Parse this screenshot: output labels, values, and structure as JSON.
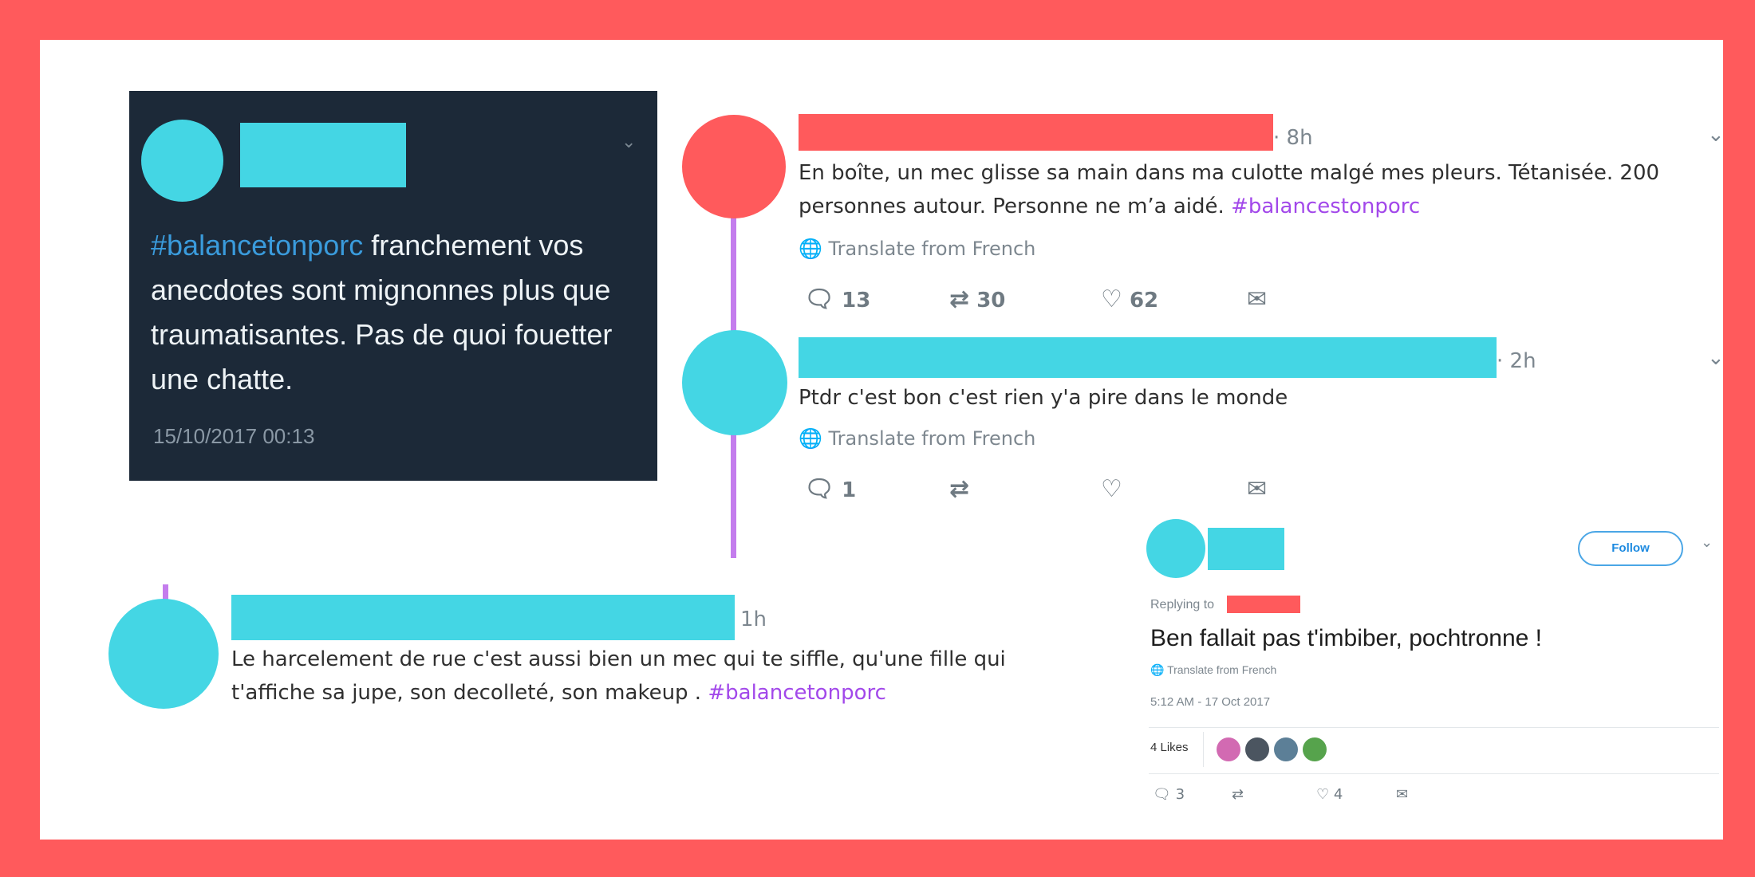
{
  "dark_tweet": {
    "hashtag": "#balancetonporc",
    "text": " franchement vos anecdotes sont mignonnes plus que traumatisantes. Pas de quoi fouetter une chatte.",
    "timestamp": "15/10/2017 00:13",
    "menu_icon": "chevron-down-icon"
  },
  "tweet_1": {
    "time": "· 8h",
    "text_line1": "En boîte, un mec glisse sa main dans ma culotte malgé mes pleurs. Tétanisée. 200",
    "text_line2": "personnes autour. Personne ne m’a aidé. ",
    "hashtag": "#balancestonporc",
    "translate": "Translate from French",
    "replies": "13",
    "retweets": "30",
    "likes": "62"
  },
  "tweet_2": {
    "time": "· 2h",
    "text": "Ptdr c'est bon c'est rien y'a pire dans le monde",
    "translate": "Translate from French",
    "replies": "1"
  },
  "tweet_3": {
    "time": "1h",
    "text_line1": "Le harcelement de rue c'est aussi bien un mec qui te siffle, qu'une fille qui",
    "text_line2": "t'affiche sa jupe, son decolleté, son makeup . ",
    "hashtag": "#balancetonporc"
  },
  "tweet_4": {
    "follow_label": "Follow",
    "replying_to": "Replying to",
    "text": "Ben fallait pas t'imbiber, pochtronne !",
    "translate": "Translate from French",
    "timestamp": "5:12 AM - 17 Oct 2017",
    "likes_label": "4 Likes",
    "replies": "3",
    "likes": "4"
  },
  "colors": {
    "frame": "#ff5a5c",
    "redaction_cyan": "#44d6e4",
    "redaction_red": "#ff5a5c",
    "hashtag_purple": "#a248ea",
    "hashtag_blue": "#3a9bdc",
    "thread_line": "#c47ded",
    "dark_card": "#1c2938"
  }
}
